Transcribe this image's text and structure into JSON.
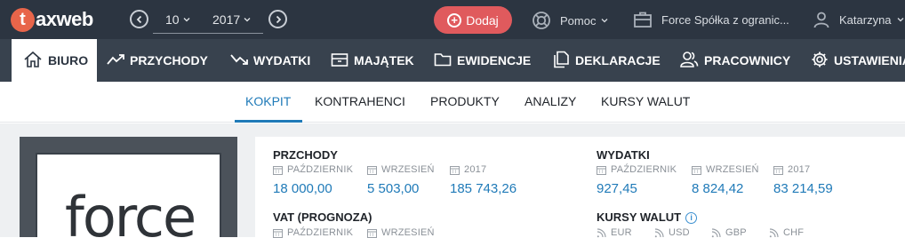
{
  "brand": {
    "logo_letter": "t",
    "logo_rest": "axweb"
  },
  "period": {
    "month": "10",
    "year": "2017"
  },
  "actions": {
    "add_label": "Dodaj",
    "help_label": "Pomoc",
    "company": "Force Spółka z ogranic...",
    "user": "Katarzyna"
  },
  "nav": {
    "items": [
      {
        "label": "BIURO",
        "icon": "home-icon"
      },
      {
        "label": "PRZYCHODY",
        "icon": "trend-up-icon"
      },
      {
        "label": "WYDATKI",
        "icon": "trend-down-icon"
      },
      {
        "label": "MAJĄTEK",
        "icon": "inventory-icon"
      },
      {
        "label": "EWIDENCJE",
        "icon": "folder-icon"
      },
      {
        "label": "DEKLARACJE",
        "icon": "documents-icon"
      },
      {
        "label": "PRACOWNICY",
        "icon": "people-icon"
      },
      {
        "label": "USTAWIENIA",
        "icon": "gear-icon"
      }
    ]
  },
  "subnav": {
    "items": [
      "KOKPIT",
      "KONTRAHENCI",
      "PRODUKTY",
      "ANALIZY",
      "KURSY WALUT"
    ]
  },
  "company_logo": {
    "text": "force"
  },
  "dashboard": {
    "income": {
      "title": "PRZCHODY",
      "periods": [
        "PAŹDZIERNIK",
        "WRZESIEŃ",
        "2017"
      ],
      "values": [
        "18 000,00",
        "5 503,00",
        "185 743,26"
      ]
    },
    "expenses": {
      "title": "WYDATKI",
      "periods": [
        "PAŹDZIERNIK",
        "WRZESIEŃ",
        "2017"
      ],
      "values": [
        "927,45",
        "8 824,42",
        "83 214,59"
      ]
    },
    "vat": {
      "title": "VAT (PROGNOZA)",
      "periods": [
        "PAŹDZIERNIK",
        "WRZESIEŃ"
      ]
    },
    "rates": {
      "title": "KURSY WALUT",
      "currencies": [
        "EUR",
        "USD",
        "GBP",
        "CHF"
      ]
    }
  },
  "colors": {
    "topbar": "#2c3541",
    "nav": "#38424e",
    "accent": "#1f7ab8",
    "add_button": "#e05a5d",
    "logo": "#e8654a"
  }
}
